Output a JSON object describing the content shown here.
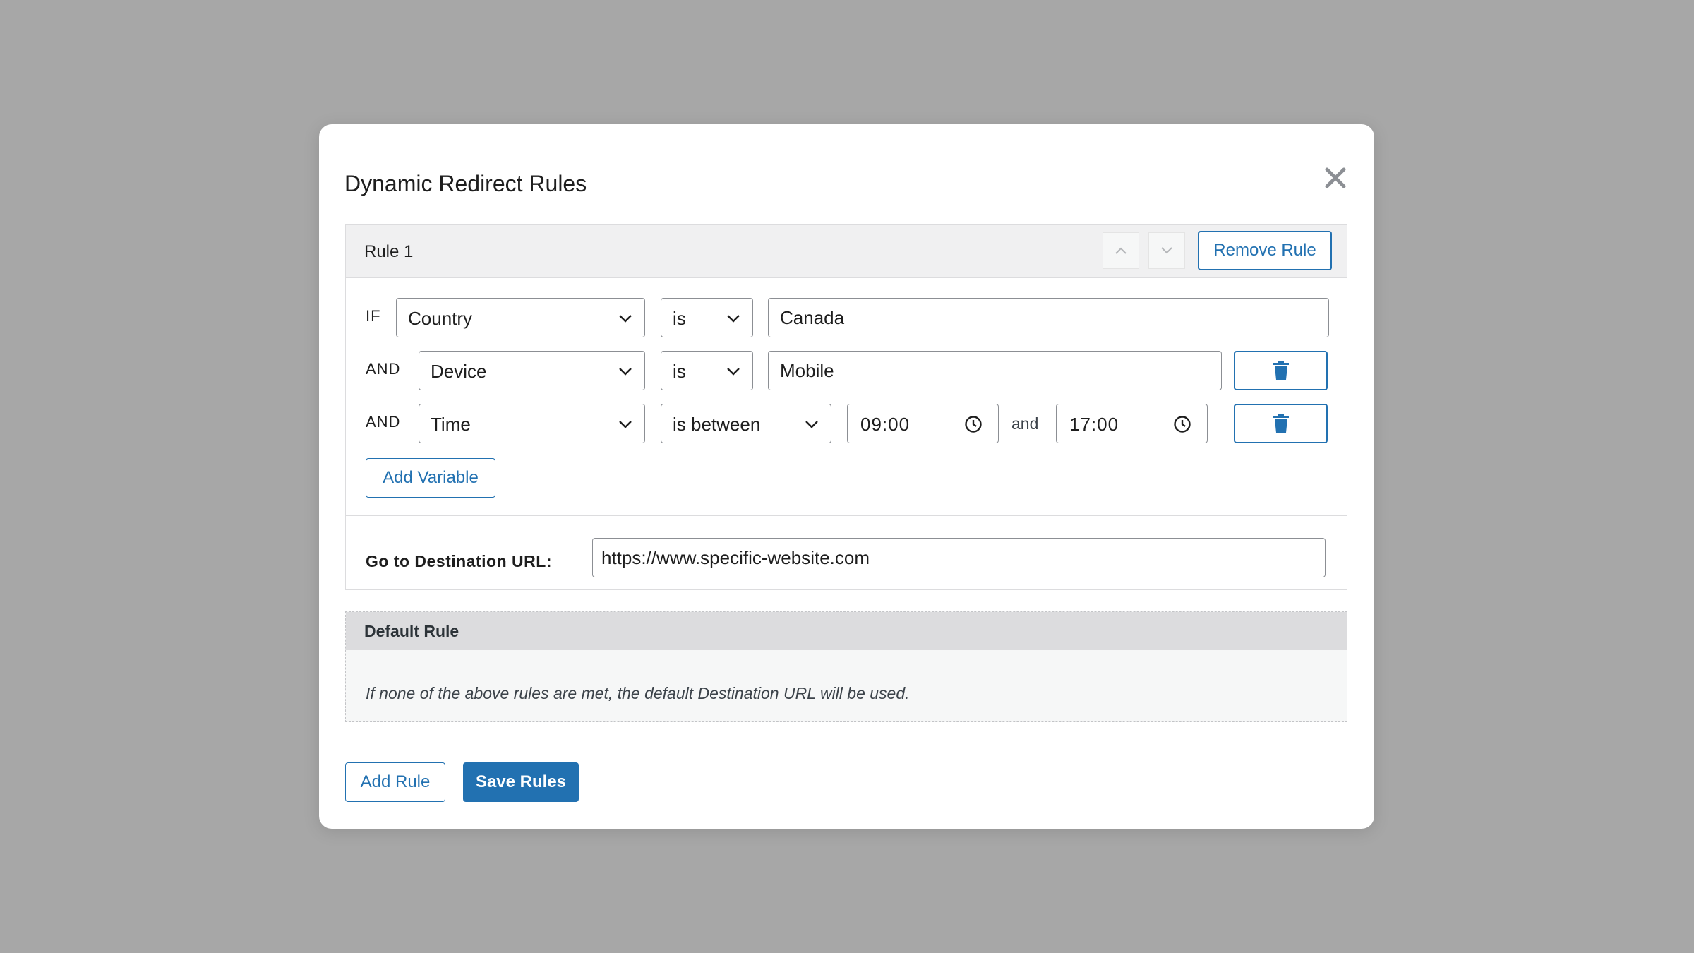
{
  "modal": {
    "title": "Dynamic Redirect Rules"
  },
  "rule": {
    "title": "Rule 1",
    "remove_label": "Remove Rule",
    "conditions": [
      {
        "connector": "IF",
        "field": "Country",
        "operator": "is",
        "value": "Canada"
      },
      {
        "connector": "AND",
        "field": "Device",
        "operator": "is",
        "value": "Mobile"
      },
      {
        "connector": "AND",
        "field": "Time",
        "operator": "is between",
        "from": "09:00",
        "and_label": "and",
        "to": "17:00"
      }
    ],
    "add_variable_label": "Add Variable",
    "destination_label": "Go to Destination URL:",
    "destination_url": "https://www.specific-website.com"
  },
  "default_rule": {
    "title": "Default Rule",
    "description": "If none of the above rules are met, the default Destination URL will be used."
  },
  "footer": {
    "add_rule_label": "Add Rule",
    "save_label": "Save Rules"
  },
  "colors": {
    "accent": "#2271b1",
    "backdrop": "#a7a7a7"
  },
  "icons": [
    "close-icon",
    "chevron-up-icon",
    "chevron-down-icon",
    "trash-icon",
    "clock-icon"
  ]
}
